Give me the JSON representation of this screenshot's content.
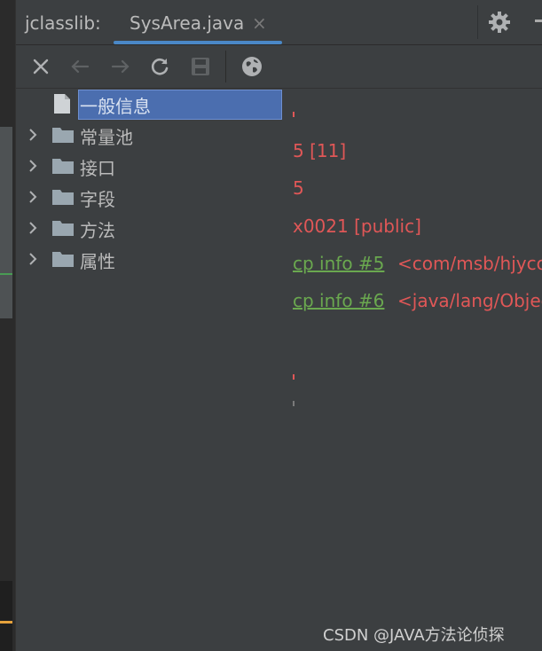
{
  "tool_window": {
    "title": "jclasslib:",
    "tab_label": "SysArea.java",
    "tab_close": "×"
  },
  "colors": {
    "accent": "#4a88c7",
    "selection": "#4b6eaf",
    "value_red": "#e05757",
    "link_green": "#6aa84f",
    "background": "#3c3f41"
  },
  "toolbar": {
    "buttons": [
      {
        "name": "close-icon",
        "glyph": "✕"
      },
      {
        "name": "back-arrow-icon",
        "glyph": "←"
      },
      {
        "name": "forward-arrow-icon",
        "glyph": "→"
      },
      {
        "name": "refresh-icon",
        "glyph": "⟳"
      },
      {
        "name": "save-icon",
        "glyph": "▣"
      },
      {
        "name": "globe-icon",
        "glyph": "◍"
      }
    ]
  },
  "tree": {
    "items": [
      {
        "label": "一般信息",
        "selected": true,
        "kind": "document"
      },
      {
        "label": "常量池",
        "selected": false,
        "kind": "folder"
      },
      {
        "label": "接口",
        "selected": false,
        "kind": "folder"
      },
      {
        "label": "字段",
        "selected": false,
        "kind": "folder"
      },
      {
        "label": "方法",
        "selected": false,
        "kind": "folder"
      },
      {
        "label": "属性",
        "selected": false,
        "kind": "folder"
      }
    ]
  },
  "detail": {
    "lines": [
      {
        "text": "5 [11]"
      },
      {
        "text": "5"
      },
      {
        "text": "x0021 [public]"
      }
    ],
    "refs": [
      {
        "link": "cp info #5",
        "value": "<com/msb/hjycommunity/SysArea>"
      },
      {
        "link": "cp info #6",
        "value": "<java/lang/Object>"
      }
    ]
  },
  "watermark": "CSDN @JAVA方法论侦探"
}
